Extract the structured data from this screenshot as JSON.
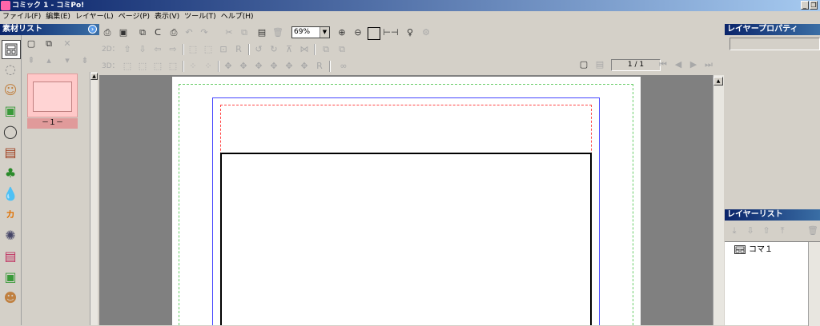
{
  "window": {
    "title": "コミック 1 - コミPo!",
    "min": "_",
    "restore": "❐"
  },
  "menu": [
    "ファイル(F)",
    "編集(E)",
    "レイヤー(L)",
    "ページ(P)",
    "表示(V)",
    "ツール(T)",
    "ヘルプ(H)"
  ],
  "material_panel": {
    "title": "素材リスト",
    "page_label": "－１－"
  },
  "toolbar": {
    "zoom_value": "69%",
    "row2_label": "2D：",
    "row3_label": "3D：",
    "page_counter": "1 / 1"
  },
  "layer_properties": {
    "title": "レイヤープロパティ"
  },
  "layer_list": {
    "title": "レイヤーリスト",
    "items": [
      {
        "label": "コマ１"
      }
    ]
  },
  "colors": {
    "titlebar": "#0a246a",
    "canvas_bg": "#808080",
    "panel_bg": "#d4d0c8",
    "thumb": "#ffc8c8",
    "thumb_footer": "#e09a9a"
  }
}
